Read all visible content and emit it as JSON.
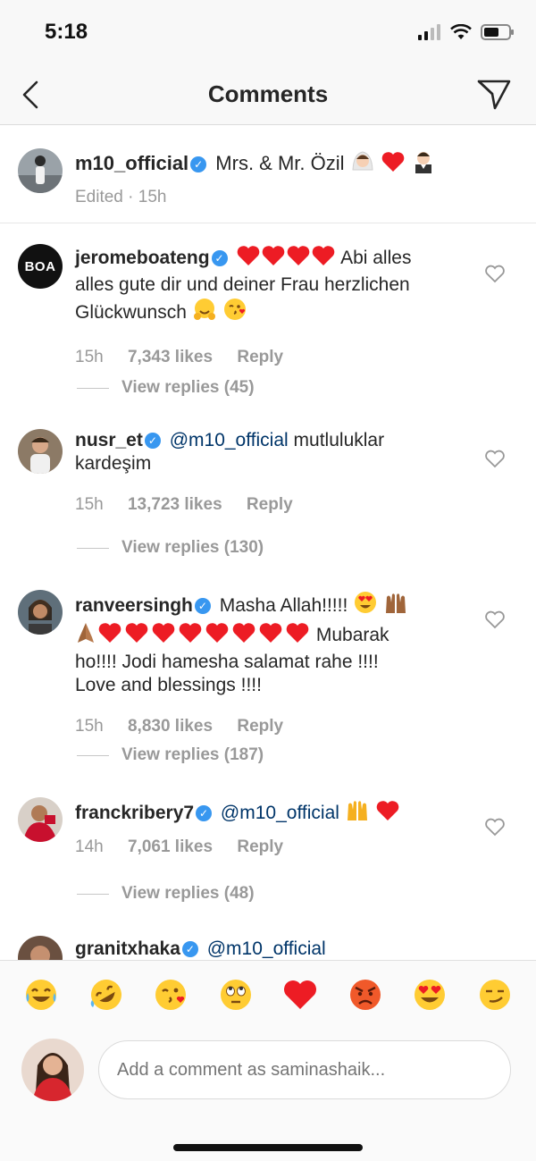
{
  "status": {
    "time": "5:18"
  },
  "nav": {
    "title": "Comments"
  },
  "caption": {
    "username": "m10_official",
    "text": "Mrs. & Mr. Özil",
    "edited": "Edited · 15h"
  },
  "comments": [
    {
      "username": "jeromeboateng",
      "avatar_text": "BOA",
      "text_line1": "Abi alles",
      "text_line2": "alles gute dir und deiner Frau herzlichen",
      "text_line3": "Glückwunsch",
      "time": "15h",
      "likes": "7,343 likes",
      "reply": "Reply",
      "view_replies": "View replies (45)"
    },
    {
      "username": "nusr_et",
      "mention": "@m10_official",
      "text_line1": "mutluluklar",
      "text_line2": "kardeşim",
      "time": "15h",
      "likes": "13,723 likes",
      "reply": "Reply",
      "view_replies": "View replies (130)"
    },
    {
      "username": "ranveersingh",
      "text_line1": "Masha Allah!!!!!",
      "text_line2": "Mubarak",
      "text_line3": "ho!!!! Jodi hamesha salamat rahe !!!!",
      "text_line4": "Love and blessings !!!!",
      "time": "15h",
      "likes": "8,830 likes",
      "reply": "Reply",
      "view_replies": "View replies (187)"
    },
    {
      "username": "franckribery7",
      "mention": "@m10_official",
      "time": "14h",
      "likes": "7,061 likes",
      "reply": "Reply",
      "view_replies": "View replies (48)"
    },
    {
      "username": "granitxhaka",
      "mention": "@m10_official"
    }
  ],
  "emoji_bar": [
    "face-with-tears-of-joy",
    "rolling-on-floor-laughing",
    "face-blowing-kiss",
    "face-with-rolling-eyes",
    "red-heart",
    "angry-face",
    "heart-eyes",
    "smirking-face"
  ],
  "compose": {
    "placeholder": "Add a comment as saminashaik..."
  },
  "colors": {
    "verified": "#3897f0",
    "mention": "#003569",
    "heart": "#ed1c24",
    "meta": "#999999"
  }
}
